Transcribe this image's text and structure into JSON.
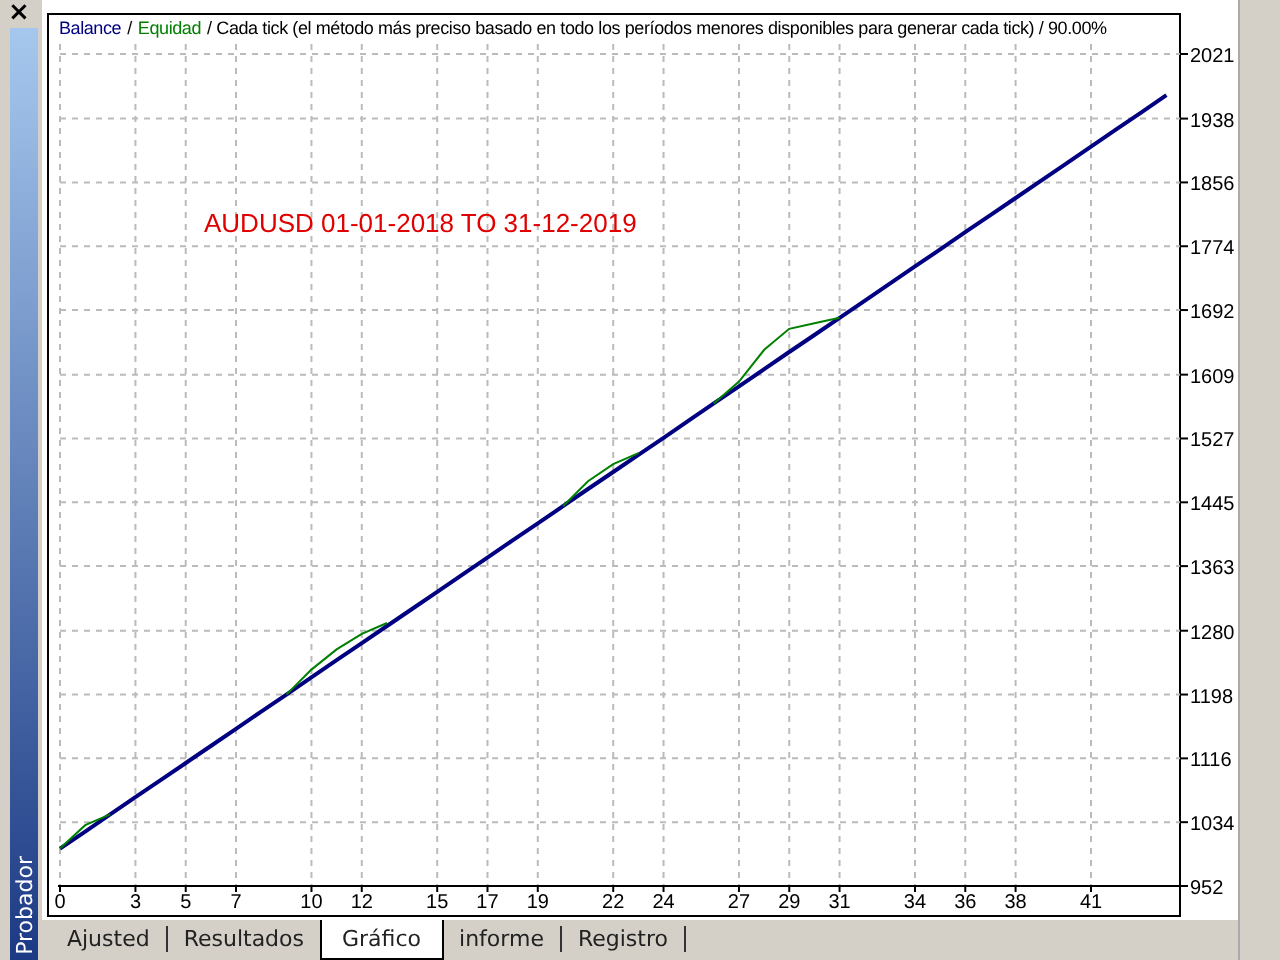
{
  "side_panel": {
    "close": "×",
    "title": "Probador"
  },
  "chart": {
    "legend_separator": "/",
    "model_text": "/ Cada tick (el método más preciso basado en todo los períodos menores disponibles para generar cada tick)  / 90.00%",
    "annotation": "AUDUSD 01-01-2018 TO 31-12-2019",
    "chart_data": {
      "type": "line",
      "x": [
        0,
        1,
        2,
        3,
        4,
        5,
        6,
        7,
        8,
        9,
        10,
        11,
        12,
        13,
        14,
        15,
        16,
        17,
        18,
        19,
        20,
        21,
        22,
        23,
        24,
        25,
        26,
        27,
        28,
        29,
        30,
        31,
        32,
        33,
        34,
        35,
        36,
        37,
        38,
        39,
        40,
        41,
        42,
        43,
        44
      ],
      "series": [
        {
          "name": "Balance",
          "color": "#000080",
          "values": [
            1000,
            1022,
            1044,
            1066,
            1088,
            1110,
            1132,
            1154,
            1176,
            1198,
            1220,
            1242,
            1264,
            1286,
            1308,
            1330,
            1352,
            1374,
            1396,
            1418,
            1440,
            1462,
            1484,
            1506,
            1528,
            1550,
            1572,
            1594,
            1616,
            1638,
            1660,
            1682,
            1704,
            1726,
            1748,
            1770,
            1792,
            1814,
            1836,
            1858,
            1880,
            1902,
            1924,
            1946,
            1968
          ]
        },
        {
          "name": "Equidad",
          "color": "#008000",
          "values": [
            1000,
            1030,
            1044,
            null,
            null,
            null,
            null,
            null,
            null,
            1198,
            1230,
            1256,
            1276,
            1290,
            null,
            null,
            null,
            null,
            null,
            null,
            1440,
            1472,
            1494,
            1508,
            null,
            null,
            1572,
            1600,
            1641,
            1668,
            1675,
            1682,
            null,
            null,
            null,
            null,
            null,
            null,
            null,
            null,
            null,
            null,
            null,
            null,
            null
          ]
        }
      ],
      "grid": true,
      "xlim": [
        0,
        44.3
      ],
      "ylim": [
        952,
        2021
      ],
      "xticks": [
        0,
        3,
        5,
        7,
        10,
        12,
        15,
        17,
        19,
        22,
        24,
        27,
        29,
        31,
        34,
        36,
        38,
        41
      ],
      "yticks": [
        952,
        1034,
        1116,
        1198,
        1280,
        1363,
        1445,
        1527,
        1609,
        1692,
        1774,
        1856,
        1938,
        2021
      ]
    }
  },
  "tabs": [
    {
      "label": "Ajusted",
      "selected": false
    },
    {
      "label": "Resultados",
      "selected": false
    },
    {
      "label": "Gráfico",
      "selected": true
    },
    {
      "label": "informe",
      "selected": false
    },
    {
      "label": "Registro",
      "selected": false
    }
  ]
}
